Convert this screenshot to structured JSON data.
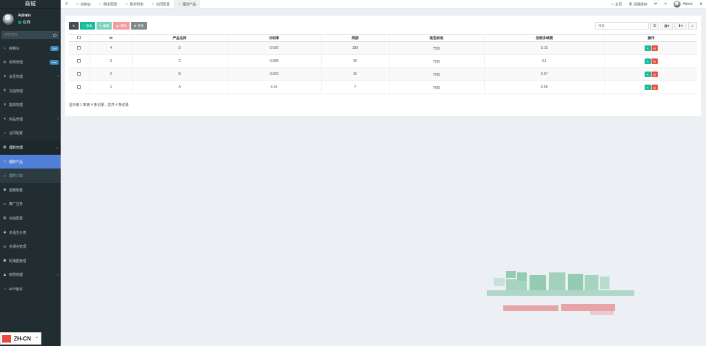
{
  "sidebar": {
    "brand": "商城",
    "user": {
      "name": "Admin",
      "status": "在线"
    },
    "search_placeholder": "搜索菜单",
    "items": [
      {
        "icon": "dashboard-icon",
        "glyph": "⌂",
        "label": "控制台",
        "badge": "hot"
      },
      {
        "icon": "cogs-icon",
        "glyph": "⚙",
        "label": "常规管理",
        "badge": "new"
      },
      {
        "icon": "user-icon",
        "glyph": "●",
        "label": "会员管理",
        "arrow": "‹"
      },
      {
        "icon": "bitcoin-icon",
        "glyph": "B",
        "label": "充值管理"
      },
      {
        "icon": "yen-icon",
        "glyph": "¥",
        "label": "提现管理"
      },
      {
        "icon": "cart-icon",
        "glyph": "▾",
        "label": "商品管理",
        "arrow": "‹"
      },
      {
        "icon": "circle-icon",
        "glyph": "○",
        "label": "合同配置"
      },
      {
        "icon": "table-icon",
        "glyph": "▦",
        "label": "理财管理",
        "arrow": "⌄",
        "open": true
      },
      {
        "icon": "circle-icon",
        "glyph": "○",
        "label": "理财产品",
        "sub": true,
        "active": true
      },
      {
        "icon": "circle-icon",
        "glyph": "○",
        "label": "理财订单",
        "sub": true,
        "dim": true
      },
      {
        "icon": "service-icon",
        "glyph": "◉",
        "label": "客服配置"
      },
      {
        "icon": "link-icon",
        "glyph": "∞",
        "label": "推广任务"
      },
      {
        "icon": "bank-icon",
        "glyph": "▤",
        "label": "充值配置"
      },
      {
        "icon": "tag-icon",
        "glyph": "◆",
        "label": "多语言分类"
      },
      {
        "icon": "globe-icon",
        "glyph": "◎",
        "label": "多语言管理"
      },
      {
        "icon": "image-icon",
        "glyph": "▣",
        "label": "轮播图管理"
      },
      {
        "icon": "users-icon",
        "glyph": "♟",
        "label": "权限管理",
        "arrow": "‹"
      },
      {
        "icon": "circle-icon",
        "glyph": "○",
        "label": "APP版本"
      }
    ],
    "lang": {
      "label": "ZH-CN",
      "flag_color": "#e74c3c"
    }
  },
  "topbar": {
    "tabs": [
      {
        "icon": "dashboard-icon",
        "glyph": "⌂",
        "label": "控制台"
      },
      {
        "icon": "circle-icon",
        "glyph": "○",
        "label": "刷单配置"
      },
      {
        "icon": "circle-icon",
        "glyph": "○",
        "label": "刷单列表"
      },
      {
        "icon": "circle-icon",
        "glyph": "○",
        "label": "合同配置"
      },
      {
        "icon": "circle-icon",
        "glyph": "○",
        "label": "理财产品",
        "active": true
      }
    ],
    "right": {
      "home_label": "主页",
      "clear_cache_label": "清除缓存",
      "admin_label": "Admin"
    }
  },
  "toolbar": {
    "add": "添加",
    "edit": "编辑",
    "delete": "删除",
    "more": "更多",
    "search_placeholder": "搜索"
  },
  "table": {
    "columns": [
      "Id",
      "产品名称",
      "日利率",
      "周期",
      "是否启用",
      "存款手续费",
      "操作"
    ],
    "rows": [
      {
        "id": "4",
        "name": "D",
        "rate": "0.096",
        "period": "180",
        "enabled": "开启",
        "fee": "0.15"
      },
      {
        "id": "3",
        "name": "C",
        "rate": "0.088",
        "period": "90",
        "enabled": "开启",
        "fee": "0.1"
      },
      {
        "id": "2",
        "name": "B",
        "rate": "0.069",
        "period": "30",
        "enabled": "开启",
        "fee": "0.07"
      },
      {
        "id": "1",
        "name": "A",
        "rate": "0.05",
        "period": "7",
        "enabled": "开启",
        "fee": "0.05"
      }
    ]
  },
  "pager": {
    "text": "显示第 1 到第 4 条记录，总共 4 条记录"
  },
  "colors": {
    "accent": "#4f7fd6",
    "green": "#18bc9c",
    "red": "#e74c3c",
    "sidebar": "#222d32"
  }
}
